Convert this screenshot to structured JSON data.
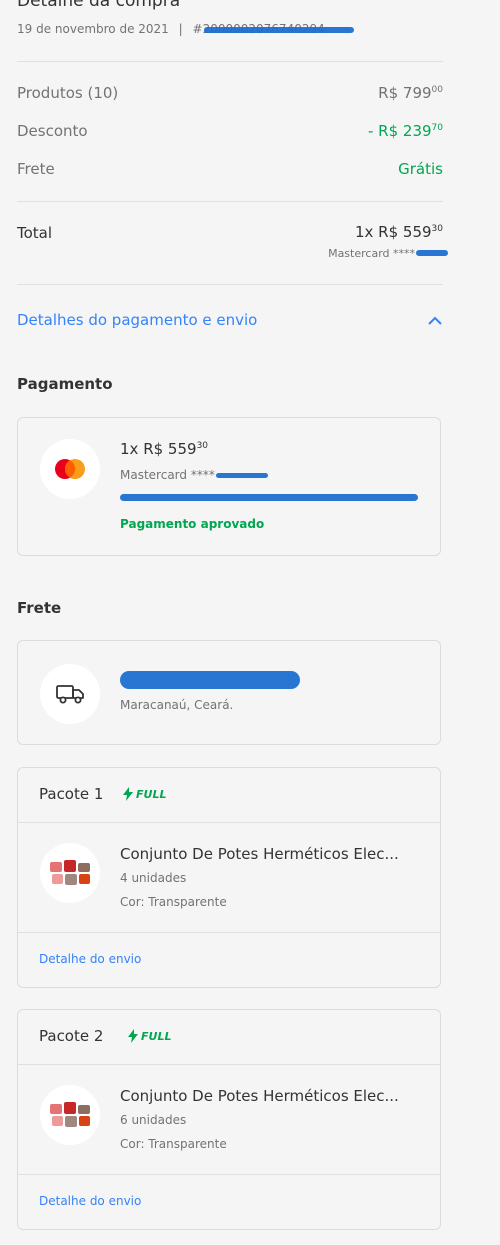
{
  "header": {
    "title": "Detalhe da compra",
    "date": "19 de novembro de 2021",
    "separator": "|",
    "order_id": "#2000002076740294"
  },
  "summary": {
    "products_label": "Produtos (10)",
    "products_value": "R$ 799",
    "products_cents": "00",
    "discount_label": "Desconto",
    "discount_value": "- R$ 239",
    "discount_cents": "70",
    "shipping_label": "Frete",
    "shipping_value": "Grátis",
    "total_label": "Total",
    "total_value": "1x R$ 559",
    "total_cents": "30",
    "total_card": "Mastercard ****"
  },
  "toggle": {
    "label": "Detalhes do pagamento e envio",
    "icon": "chevron-up-icon"
  },
  "payment": {
    "section_title": "Pagamento",
    "amount": "1x R$ 559",
    "amount_cents": "30",
    "card": "Mastercard ****",
    "status": "Pagamento aprovado",
    "icon": "mastercard-icon"
  },
  "shipping": {
    "section_title": "Frete",
    "location": "Maracanaú, Ceará.",
    "icon": "truck-icon"
  },
  "packages": [
    {
      "title": "Pacote 1",
      "badge": "FULL",
      "product_name": "Conjunto De Potes Herméticos Elec...",
      "quantity": "4 unidades",
      "variant": "Cor: Transparente",
      "link": "Detalhe do envio"
    },
    {
      "title": "Pacote 2",
      "badge": "FULL",
      "product_name": "Conjunto De Potes Herméticos Elec...",
      "quantity": "6 unidades",
      "variant": "Cor: Transparente",
      "link": "Detalhe do envio"
    }
  ],
  "colors": {
    "accent": "#3483fa",
    "success": "#00a650",
    "background": "#f5f5f5"
  }
}
